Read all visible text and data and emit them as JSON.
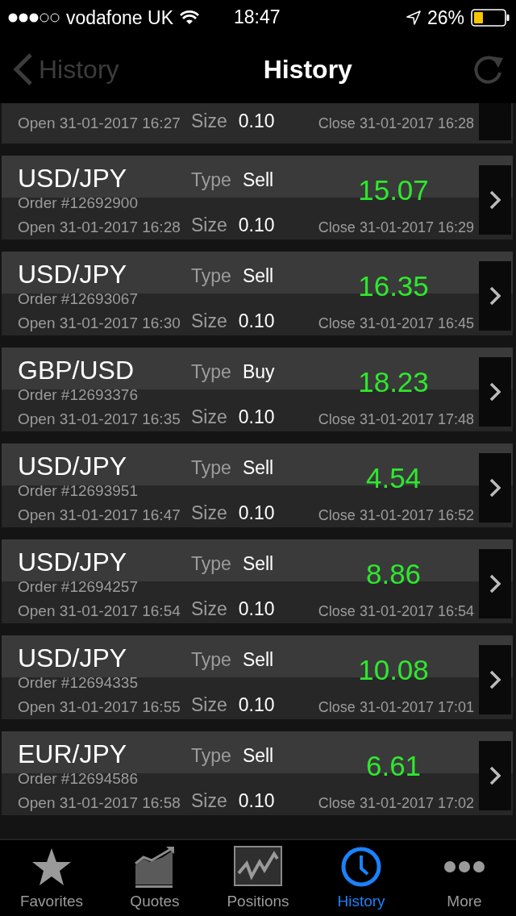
{
  "status_bar": {
    "carrier": "vodafone UK",
    "time": "18:47",
    "battery": "26%"
  },
  "nav": {
    "back_label": "History",
    "title": "History"
  },
  "trades": [
    {
      "kind": "partial",
      "open": "Open 31-01-2017 16:27",
      "size_label": "Size",
      "size": "0.10",
      "close": "Close 31-01-2017 16:28"
    },
    {
      "kind": "full",
      "symbol": "USD/JPY",
      "order": "Order #12692900",
      "open": "Open 31-01-2017 16:28",
      "type_label": "Type",
      "type": "Sell",
      "size_label": "Size",
      "size": "0.10",
      "profit": "15.07",
      "close": "Close 31-01-2017 16:29"
    },
    {
      "kind": "full",
      "symbol": "USD/JPY",
      "order": "Order #12693067",
      "open": "Open 31-01-2017 16:30",
      "type_label": "Type",
      "type": "Sell",
      "size_label": "Size",
      "size": "0.10",
      "profit": "16.35",
      "close": "Close 31-01-2017 16:45"
    },
    {
      "kind": "full",
      "symbol": "GBP/USD",
      "order": "Order #12693376",
      "open": "Open 31-01-2017 16:35",
      "type_label": "Type",
      "type": "Buy",
      "size_label": "Size",
      "size": "0.10",
      "profit": "18.23",
      "close": "Close 31-01-2017 17:48"
    },
    {
      "kind": "full",
      "symbol": "USD/JPY",
      "order": "Order #12693951",
      "open": "Open 31-01-2017 16:47",
      "type_label": "Type",
      "type": "Sell",
      "size_label": "Size",
      "size": "0.10",
      "profit": "4.54",
      "close": "Close 31-01-2017 16:52"
    },
    {
      "kind": "full",
      "symbol": "USD/JPY",
      "order": "Order #12694257",
      "open": "Open 31-01-2017 16:54",
      "type_label": "Type",
      "type": "Sell",
      "size_label": "Size",
      "size": "0.10",
      "profit": "8.86",
      "close": "Close 31-01-2017 16:54"
    },
    {
      "kind": "full",
      "symbol": "USD/JPY",
      "order": "Order #12694335",
      "open": "Open 31-01-2017 16:55",
      "type_label": "Type",
      "type": "Sell",
      "size_label": "Size",
      "size": "0.10",
      "profit": "10.08",
      "close": "Close 31-01-2017 17:01"
    },
    {
      "kind": "full",
      "symbol": "EUR/JPY",
      "order": "Order #12694586",
      "open": "Open 31-01-2017 16:58",
      "type_label": "Type",
      "type": "Sell",
      "size_label": "Size",
      "size": "0.10",
      "profit": "6.61",
      "close": "Close 31-01-2017 17:02"
    }
  ],
  "tabs": [
    {
      "label": "Favorites",
      "selected": false
    },
    {
      "label": "Quotes",
      "selected": false
    },
    {
      "label": "Positions",
      "selected": false
    },
    {
      "label": "History",
      "selected": true
    },
    {
      "label": "More",
      "selected": false
    }
  ]
}
